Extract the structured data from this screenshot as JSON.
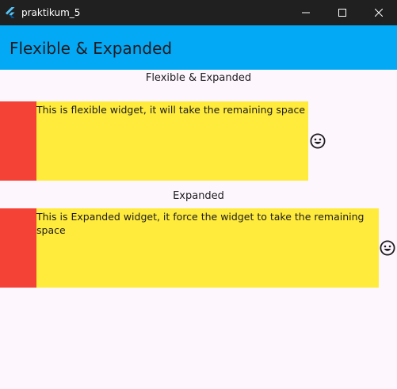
{
  "window": {
    "title": "praktikum_5",
    "colors": {
      "titlebar": "#202020",
      "titlebar_text": "#ffffff"
    }
  },
  "appbar": {
    "title": "Flexible & Expanded",
    "color": "#03a9f4"
  },
  "sections": [
    {
      "heading": "Flexible & Expanded",
      "text": "This is flexible widget, it will take the remaining space",
      "trailing_icon": "smiley-face-icon"
    },
    {
      "heading": "Expanded",
      "text": "This is Expanded widget, it force the widget to take the remaining space",
      "trailing_icon": "smiley-face-icon"
    }
  ],
  "colors": {
    "red_box": "#f44336",
    "yellow_box": "#ffeb3b",
    "background": "#fdf7fd"
  },
  "icons": {
    "app": "flutter-logo-icon",
    "minimize": "minimize-icon",
    "maximize": "maximize-icon",
    "close": "close-icon"
  }
}
